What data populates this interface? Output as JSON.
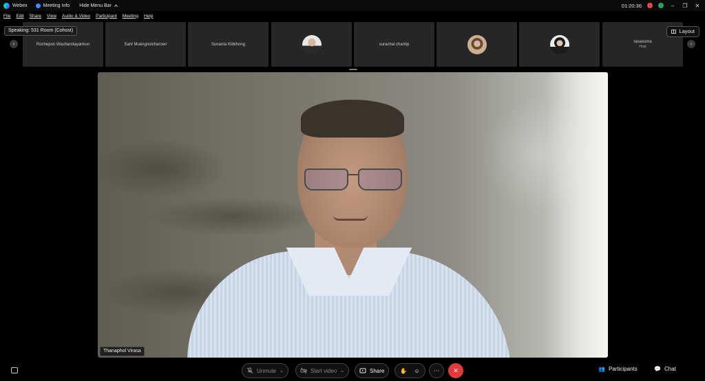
{
  "titlebar": {
    "app_name": "Webex",
    "meeting_info": "Meeting Info",
    "hide_menu_bar": "Hide Menu Bar",
    "time": "01:20:36"
  },
  "menu": [
    "File",
    "Edit",
    "Share",
    "View",
    "Audio & Video",
    "Participant",
    "Meeting",
    "Help"
  ],
  "speaking_banner": "Speaking: 531 Room (Cohost)",
  "layout_button": "Layout",
  "participants": [
    {
      "name": "Rochepon Wacharotayankun",
      "type": "name"
    },
    {
      "name": "Sant Muengnoicharoen",
      "type": "name"
    },
    {
      "name": "Sunanta Klibthong",
      "type": "name"
    },
    {
      "name": "",
      "type": "avatar",
      "avatar": "man-avatar"
    },
    {
      "name": "surachai.chantip",
      "type": "name"
    },
    {
      "name": "",
      "type": "avatar",
      "avatar": "woman-avatar"
    },
    {
      "name": "",
      "type": "avatar",
      "avatar": "woman-avatar-2"
    },
    {
      "name": "rasasuma",
      "type": "name",
      "sub": "Host"
    }
  ],
  "main_video": {
    "speaker_name": "Thanaphol Virasa"
  },
  "controls": {
    "unmute": "Unmute",
    "start_video": "Start video",
    "share": "Share",
    "more": "⋯",
    "end": "✕",
    "participants": "Participants",
    "chat": "Chat"
  }
}
